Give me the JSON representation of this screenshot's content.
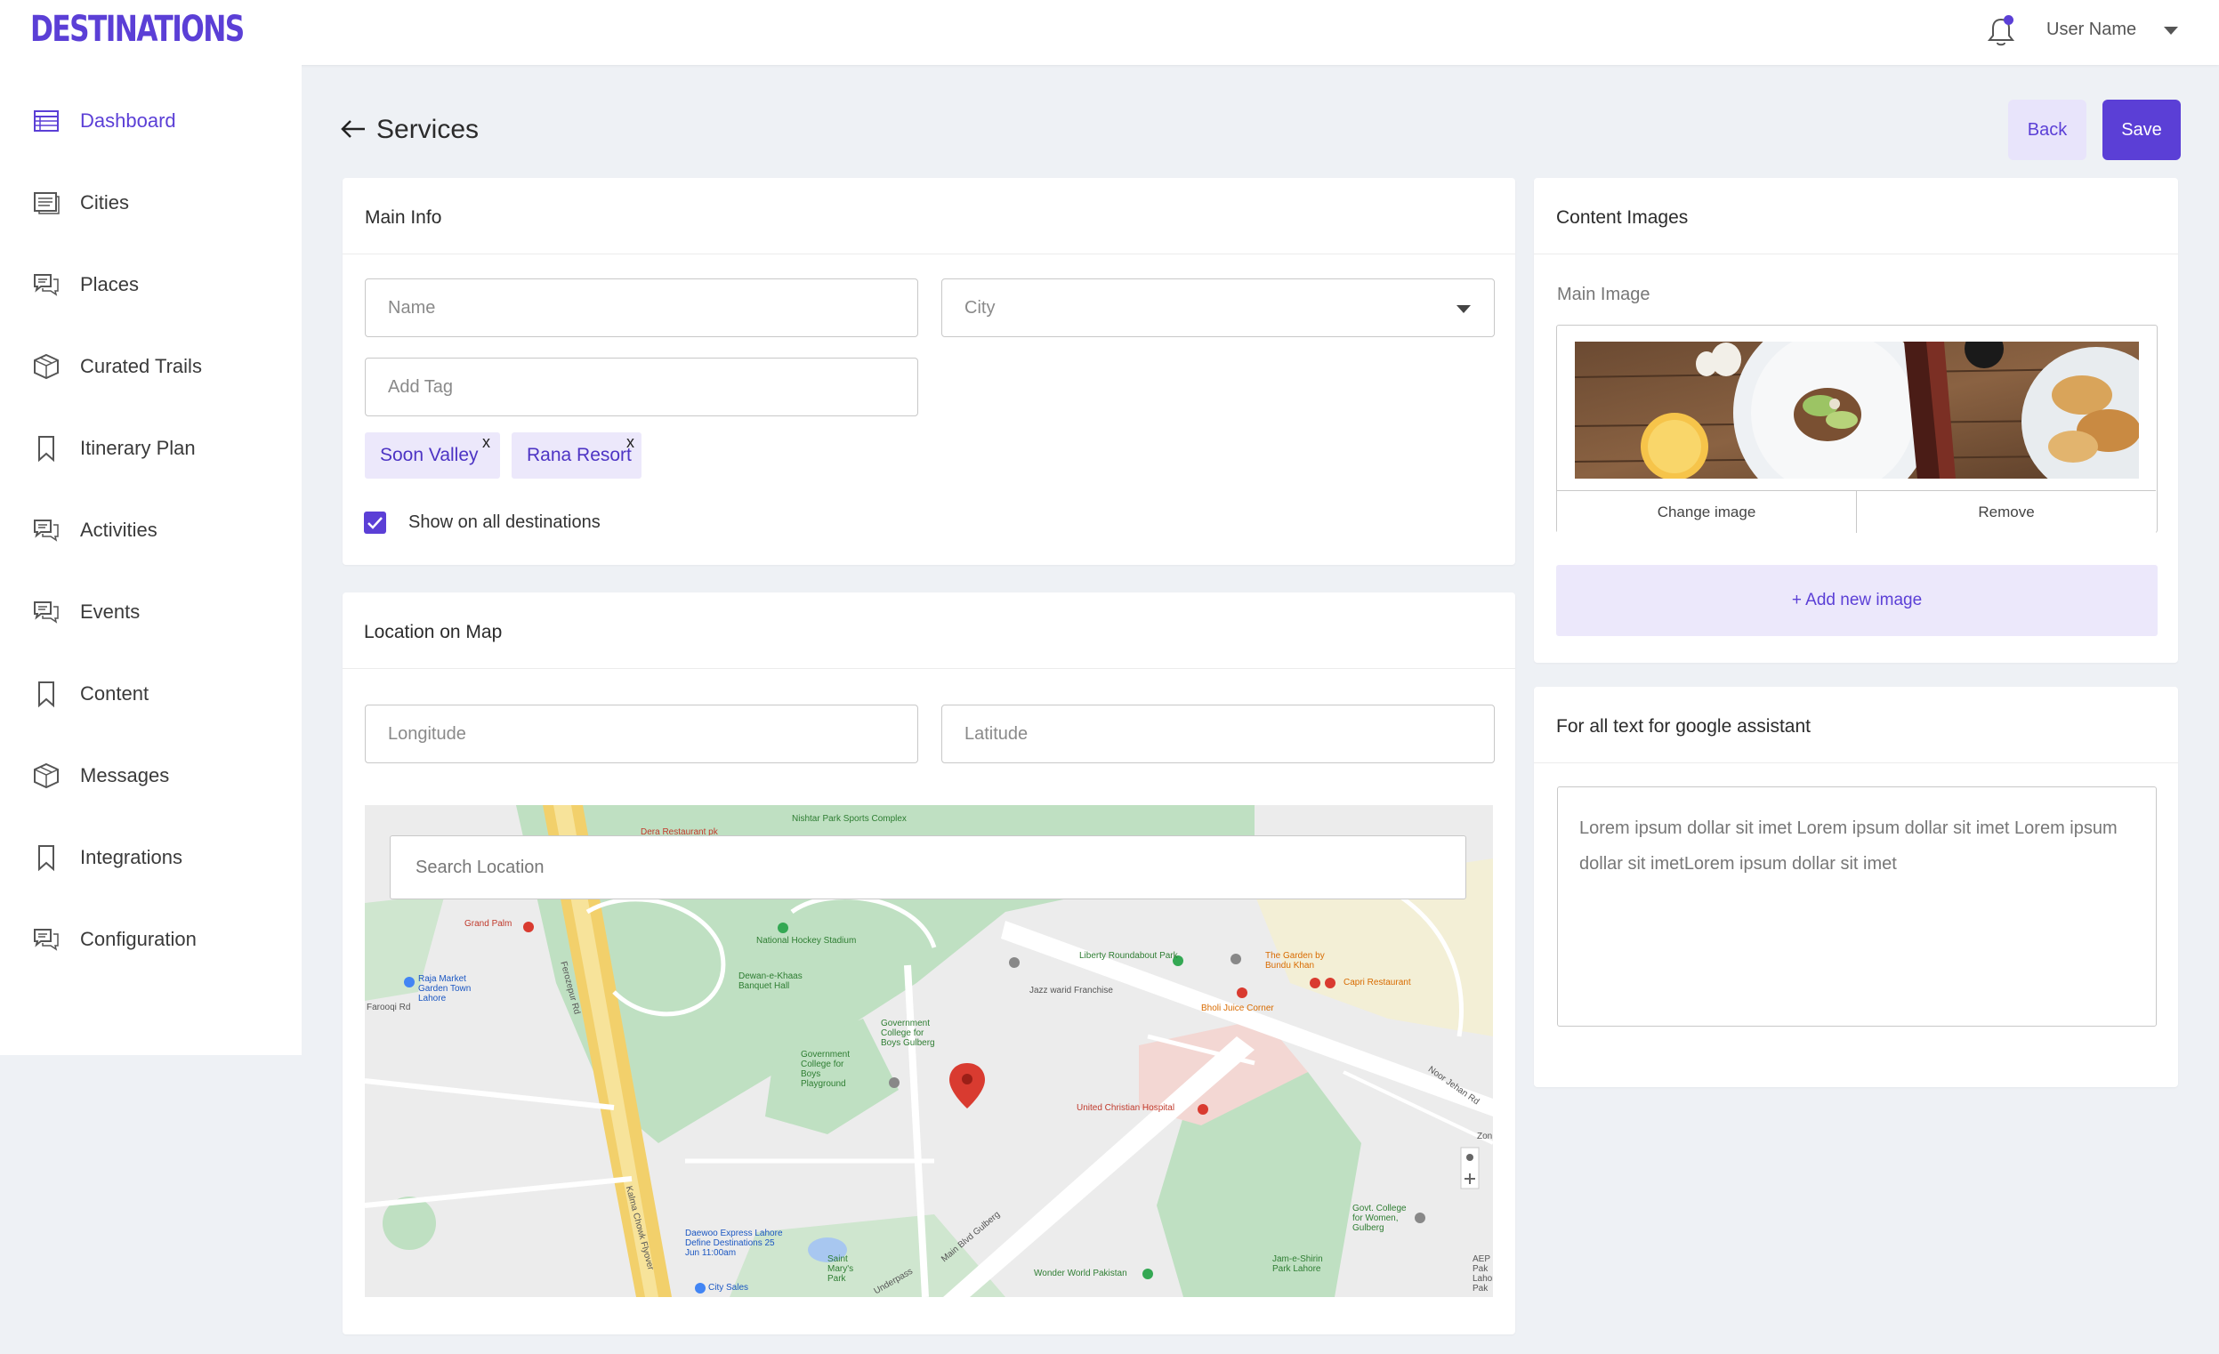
{
  "app": {
    "logo": "DESTINATIONS",
    "user_name": "User Name"
  },
  "sidebar": {
    "items": [
      {
        "label": "Dashboard",
        "icon": "table-icon"
      },
      {
        "label": "Cities",
        "icon": "list-card-icon"
      },
      {
        "label": "Places",
        "icon": "chat-icon"
      },
      {
        "label": "Curated Trails",
        "icon": "box-icon"
      },
      {
        "label": "Itinerary Plan",
        "icon": "bookmark-icon"
      },
      {
        "label": "Activities",
        "icon": "chat-icon"
      },
      {
        "label": "Events",
        "icon": "chat-icon"
      },
      {
        "label": "Content",
        "icon": "bookmark-icon"
      },
      {
        "label": "Messages",
        "icon": "box-icon"
      },
      {
        "label": "Integrations",
        "icon": "bookmark-icon"
      },
      {
        "label": "Configuration",
        "icon": "chat-icon"
      }
    ],
    "active": "Dashboard"
  },
  "page": {
    "title": "Services",
    "back_label": "Back",
    "save_label": "Save"
  },
  "main_info": {
    "title": "Main Info",
    "name_placeholder": "Name",
    "city_placeholder": "City",
    "tag_placeholder": "Add Tag",
    "tags": [
      "Soon Valley",
      "Rana Resort"
    ],
    "tag_remove": "x",
    "show_all_label": "Show on all destinations",
    "show_all_checked": true
  },
  "location": {
    "title": "Location on Map",
    "longitude_placeholder": "Longitude",
    "latitude_placeholder": "Latitude",
    "search_placeholder": "Search Location",
    "map_labels": {
      "nishtar": "Nishtar Park Sports Complex",
      "dera": "Dera Restaurant pk",
      "grand_palm": "Grand Palm",
      "national_hockey": "National Hockey Stadium",
      "dewan": "Dewan-e-Khaas Banquet Hall",
      "raja_market": "Raja Market Garden Town Lahore",
      "farooqi": "Farooqi Rd",
      "ferozpur": "Ferozepur Rd",
      "liberty": "Liberty Roundabout Park",
      "garden_bundu": "The Garden by Bundu Khan",
      "capri": "Capri Restaurant",
      "jazz": "Jazz warid Franchise",
      "bholi": "Bholi Juice Corner",
      "gov_college": "Government College for Boys Gulberg",
      "gov_college2": "Government College for Boys Playground",
      "ucp": "United Christian Hospital",
      "noor_jehan": "Noor Jehan Rd",
      "main_blvd": "Main Blvd Gulberg",
      "kalma": "Kalma Chowk Flyover",
      "daewoo": "Daewoo Express Lahore Define Destinations 25 Jun 11:00am",
      "saint_mary": "Saint Mary's Park",
      "city_sales": "City Sales",
      "wonder": "Wonder World Pakistan",
      "jam_e_shirin": "Jam-e-Shirin Park Lahore",
      "govt_women": "Govt. College for Women, Gulberg",
      "underpass": "Underpass",
      "zon": "Zon",
      "aep": "AEP Pak Lahore Pak"
    }
  },
  "content_images": {
    "title": "Content Images",
    "main_image_label": "Main Image",
    "change_label": "Change image",
    "remove_label": "Remove",
    "add_label": "+ Add new image"
  },
  "assistant": {
    "title": "For all text for google assistant",
    "text": "Lorem ipsum dollar sit imet Lorem ipsum dollar sit imet Lorem ipsum dollar sit imetLorem ipsum dollar sit imet"
  },
  "colors": {
    "accent": "#5b3fd6",
    "accent_light": "#ece8fb",
    "background": "#eef1f5",
    "map_marker": "#d93b30"
  }
}
